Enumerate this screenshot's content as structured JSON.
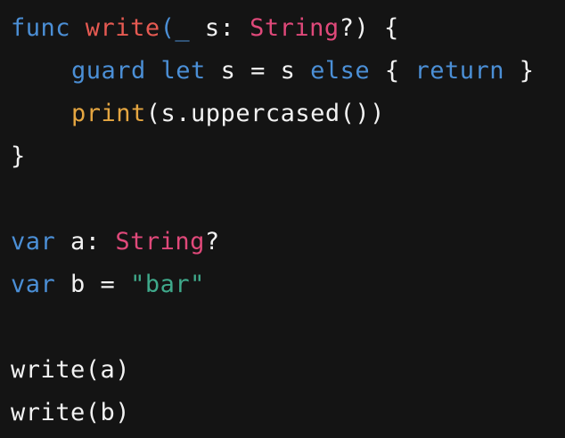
{
  "colors": {
    "background": "#141414",
    "plain": "#f2f2f2",
    "keyword": "#4b8fd6",
    "type": "#e0497a",
    "function_name": "#e65a52",
    "builtin_function": "#e5a641",
    "string": "#3fa98b"
  },
  "lines": [
    {
      "indent": 0,
      "tokens": [
        {
          "text": "func",
          "kind": "keyword"
        },
        {
          "text": " ",
          "kind": "plain"
        },
        {
          "text": "write",
          "kind": "function_name"
        },
        {
          "text": "(",
          "kind": "keyword"
        },
        {
          "text": "_",
          "kind": "keyword"
        },
        {
          "text": " s: ",
          "kind": "plain"
        },
        {
          "text": "String",
          "kind": "type"
        },
        {
          "text": "?) {",
          "kind": "plain"
        }
      ]
    },
    {
      "indent": 1,
      "tokens": [
        {
          "text": "guard",
          "kind": "keyword"
        },
        {
          "text": " ",
          "kind": "plain"
        },
        {
          "text": "let",
          "kind": "keyword"
        },
        {
          "text": " s = s ",
          "kind": "plain"
        },
        {
          "text": "else",
          "kind": "keyword"
        },
        {
          "text": " { ",
          "kind": "plain"
        },
        {
          "text": "return",
          "kind": "keyword"
        },
        {
          "text": " }",
          "kind": "plain"
        }
      ]
    },
    {
      "indent": 1,
      "tokens": [
        {
          "text": "print",
          "kind": "builtin_function"
        },
        {
          "text": "(s.uppercased())",
          "kind": "plain"
        }
      ]
    },
    {
      "indent": 0,
      "tokens": [
        {
          "text": "}",
          "kind": "plain"
        }
      ]
    },
    {
      "indent": 0,
      "tokens": []
    },
    {
      "indent": 0,
      "tokens": [
        {
          "text": "var",
          "kind": "keyword"
        },
        {
          "text": " a: ",
          "kind": "plain"
        },
        {
          "text": "String",
          "kind": "type"
        },
        {
          "text": "?",
          "kind": "plain"
        }
      ]
    },
    {
      "indent": 0,
      "tokens": [
        {
          "text": "var",
          "kind": "keyword"
        },
        {
          "text": " b = ",
          "kind": "plain"
        },
        {
          "text": "\"bar\"",
          "kind": "string"
        }
      ]
    },
    {
      "indent": 0,
      "tokens": []
    },
    {
      "indent": 0,
      "tokens": [
        {
          "text": "write(a)",
          "kind": "plain"
        }
      ]
    },
    {
      "indent": 0,
      "tokens": [
        {
          "text": "write(b)",
          "kind": "plain"
        }
      ]
    }
  ]
}
